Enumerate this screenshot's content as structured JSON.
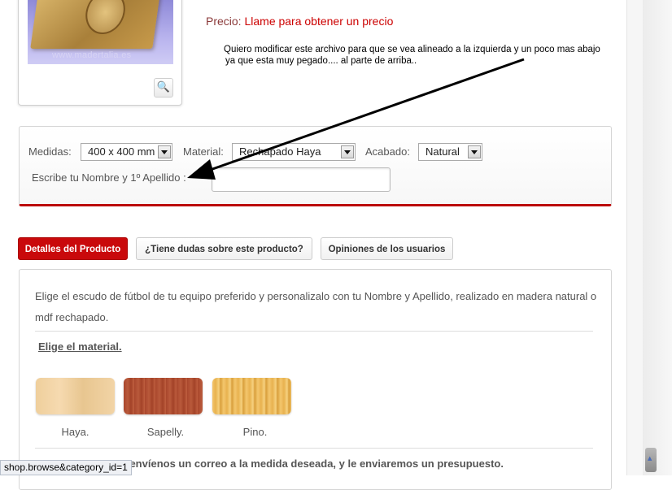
{
  "product": {
    "image_watermark": "www.madertalia.es",
    "price_label": "Precio:",
    "price_value": "Llame para obtener un precio"
  },
  "annotation": {
    "line1": "Quiero modificar este archivo para que se vea alineado a la izquierda y un poco mas abajo",
    "line2": "ya que esta  muy pegado.... al parte de arriba.."
  },
  "options": {
    "medidas_label": "Medidas:",
    "medidas_value": "400 x 400 mm",
    "material_label": "Material:",
    "material_value": "Rechapado Haya",
    "acabado_label": "Acabado:",
    "acabado_value": "Natural",
    "name_label": "Escribe tu Nombre y 1º Apellido :",
    "name_value": ""
  },
  "tabs": [
    {
      "label": "Detalles del Producto",
      "active": true
    },
    {
      "label": "¿Tiene dudas sobre este producto?",
      "active": false
    },
    {
      "label": "Opiniones de los usuarios",
      "active": false
    }
  ],
  "details": {
    "description": "Elige el escudo de fútbol de tu equipo preferido y personalizalo con tu Nombre y Apellido, realizado en madera natural o mdf rechapado.",
    "material_title": "Elige el material.",
    "materials": [
      {
        "label": "Haya.",
        "color": "#f2d4a6"
      },
      {
        "label": "Sapelly.",
        "color": "#b0502f"
      },
      {
        "label": "Pino.",
        "color": "#f0c065"
      }
    ],
    "bottom_text": "s, envíenos un correo a la medida deseada, y le enviaremos un presupuesto."
  },
  "status_bar": {
    "url": "shop.browse&category_id=1"
  },
  "colors": {
    "accent": "#c9090b",
    "price_value": "#cc0000"
  }
}
